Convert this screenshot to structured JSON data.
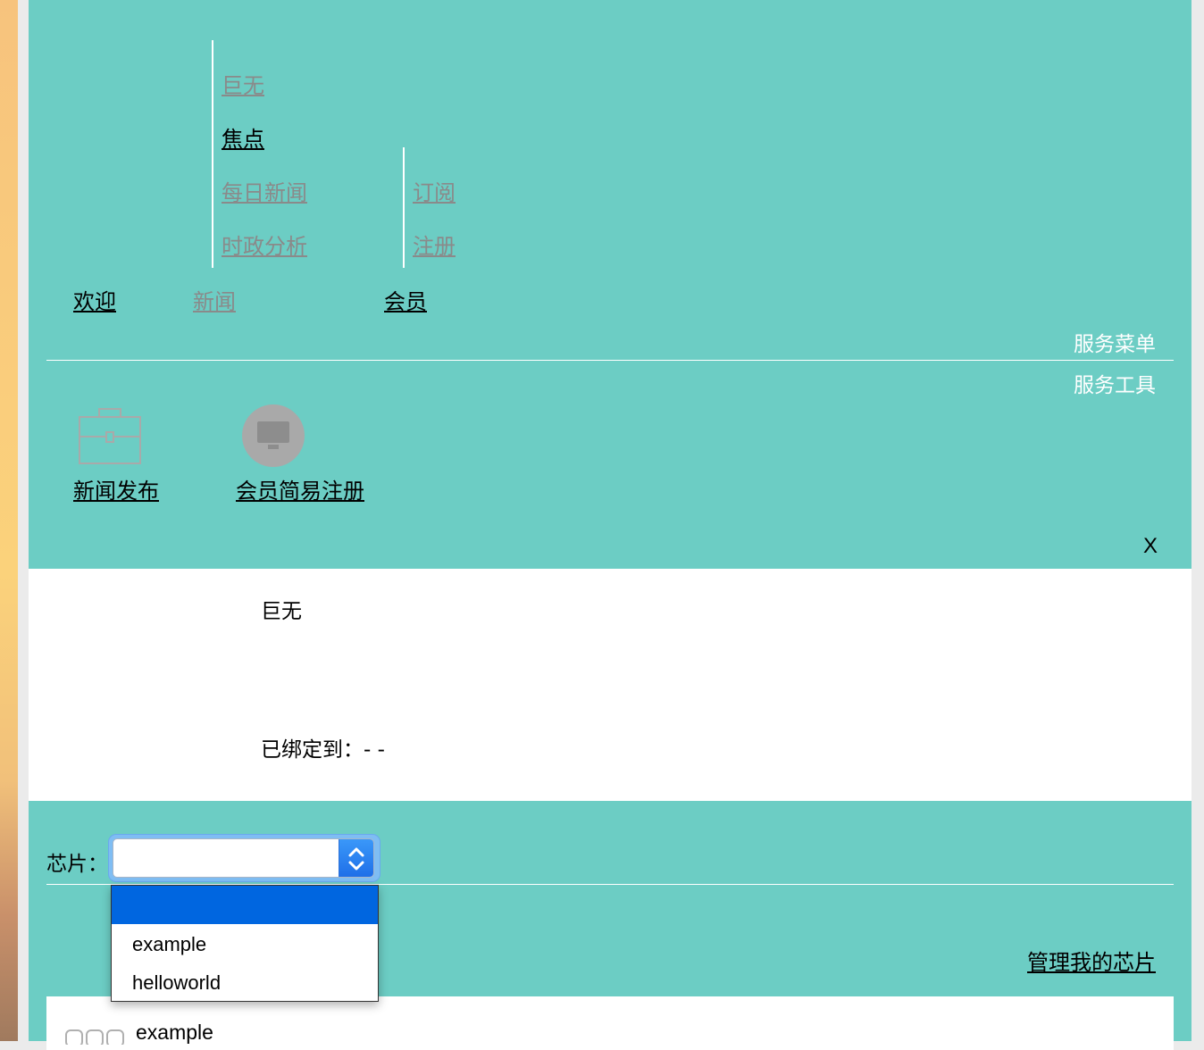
{
  "nav": {
    "news_submenu": [
      "巨无",
      "焦点",
      "每日新闻",
      "时政分析"
    ],
    "member_submenu": [
      "订阅",
      "注册"
    ],
    "main": [
      "欢迎",
      "新闻",
      "会员"
    ]
  },
  "service": {
    "menu_label": "服务菜单",
    "tools_label": "服务工具",
    "tools": [
      "新闻发布",
      "会员简易注册"
    ],
    "close_label": "X"
  },
  "info": {
    "name": "巨无",
    "bound_label": "已绑定到：-   -"
  },
  "chip": {
    "label": "芯片：",
    "selected": "",
    "options": [
      "",
      "example",
      "helloworld"
    ],
    "manage_link": "管理我的芯片"
  },
  "list": {
    "first_item": "example"
  }
}
